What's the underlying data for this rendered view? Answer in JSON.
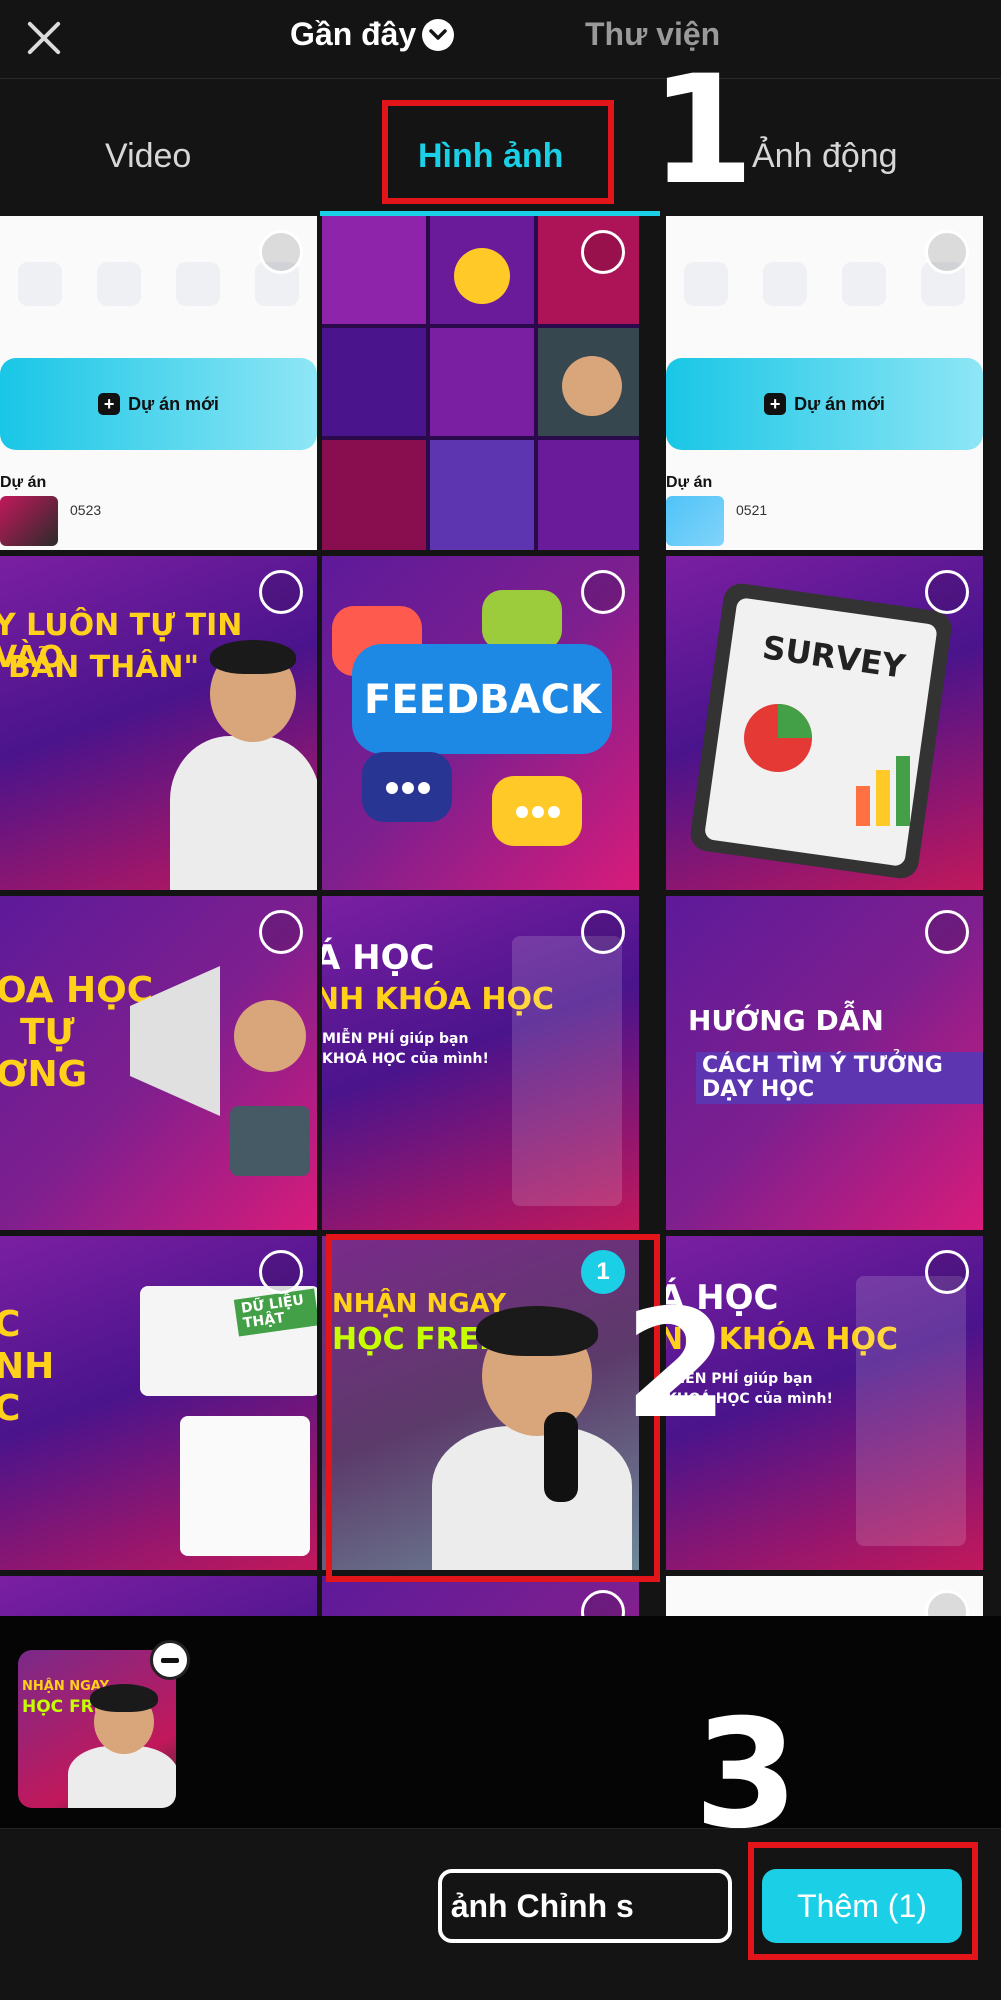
{
  "header": {
    "close_icon": "close-icon",
    "source_recent": "Gần đây",
    "source_library": "Thư viện"
  },
  "tabs": [
    {
      "label": "Video"
    },
    {
      "label": "Hình ảnh",
      "active": true
    },
    {
      "label": "Ảnh động"
    }
  ],
  "annotations": [
    "1",
    "2",
    "3"
  ],
  "grid": {
    "items": [
      {
        "kind": "app-screenshot",
        "project_label": "Dự án",
        "button_label": "Dự án mới",
        "project_date": "0523"
      },
      {
        "kind": "collage"
      },
      {
        "kind": "app-screenshot",
        "project_label": "Dự án",
        "button_label": "Dự án mới",
        "project_date": "0521"
      },
      {
        "kind": "promo",
        "text_line1": "Y LUÔN TỰ TIN VÀO",
        "text_line2": "BẢN THÂN\""
      },
      {
        "kind": "feedback",
        "text": "FEEDBACK"
      },
      {
        "kind": "survey",
        "text": "SURVEY"
      },
      {
        "kind": "megaphone",
        "text_line1": "OA HỌC",
        "text_line2": "TỰ",
        "text_line3": "ƠNG"
      },
      {
        "kind": "course",
        "text_line1": "Á HỌC",
        "text_line2": "NH KHÓA HỌC",
        "text_line3": "MIỄN PHÍ giúp bạn",
        "text_line4": "KHOÁ HỌC của mình!"
      },
      {
        "kind": "guide",
        "text_line1": "HƯỚNG DẪN",
        "text_line2": "CÁCH TÌM Ý TƯỞNG DẠY HỌC"
      },
      {
        "kind": "dashboard",
        "text_line1": "C",
        "text_line2": "NH",
        "text_line3": "C",
        "stamp": "DỮ LIỆU THẬT"
      },
      {
        "kind": "selected",
        "badge": "1",
        "text_line1": "NHẬN NGAY",
        "text_line2": "HỌC FREE"
      },
      {
        "kind": "course",
        "text_line1": "Á HỌC",
        "text_line2": "NH KHÓA HỌC",
        "text_line3": "MIỄN PHÍ giúp bạn",
        "text_line4": "KHOÁ HỌC của mình!"
      }
    ]
  },
  "tray": {
    "selected_thumb_label_1": "NHẬN NGAY",
    "selected_thumb_label_2": "HỌC FREE"
  },
  "actions": {
    "edit_label": "a ảnh   Chỉnh s",
    "add_label": "Thêm (1)"
  },
  "colors": {
    "accent": "#1bd0e6",
    "annotation_red": "#e2161a",
    "background": "#141414"
  }
}
